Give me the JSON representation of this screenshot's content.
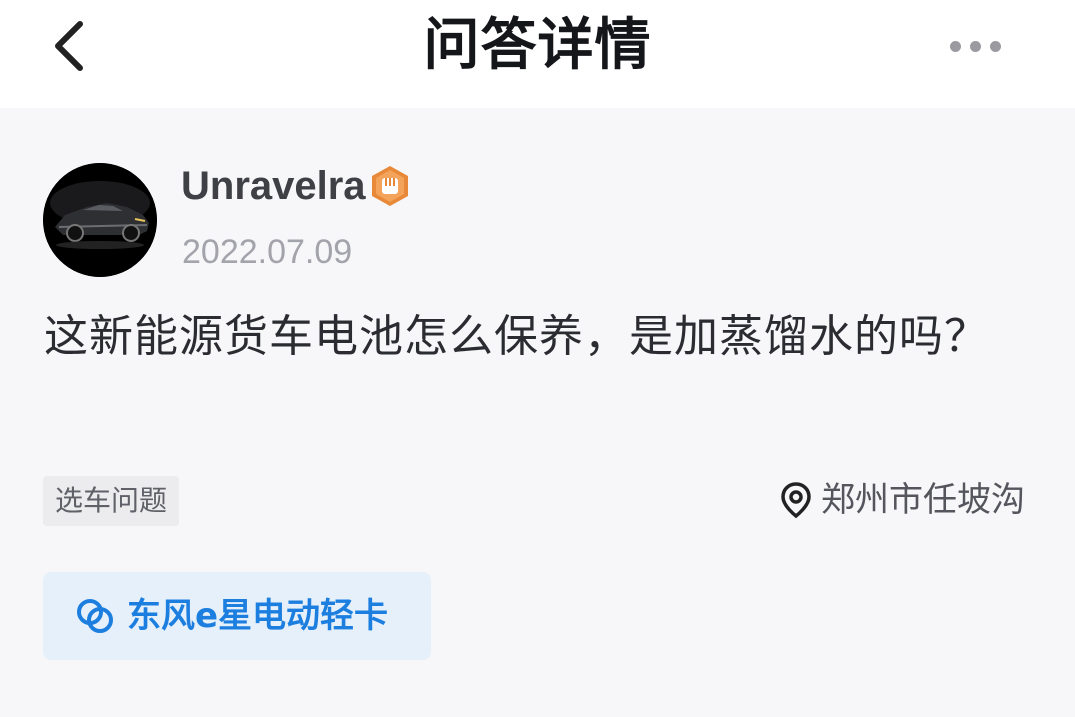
{
  "header": {
    "title": "问答详情",
    "back_icon": "chevron-left-icon",
    "more_icon": "more-dots-icon"
  },
  "author": {
    "name": "Unravelra",
    "badge_icon": "fist-badge-icon",
    "date": "2022.07.09",
    "avatar_icon": "sports-car-avatar"
  },
  "question": {
    "text": "这新能源货车电池怎么保养，是加蒸馏水的吗？"
  },
  "tag": {
    "label": "选车问题"
  },
  "location": {
    "icon": "location-pin-icon",
    "text": "郑州市任坡沟"
  },
  "vehicle": {
    "icon": "linked-rings-icon",
    "name": "东风e星电动轻卡"
  },
  "colors": {
    "accent": "#1c7fe0",
    "badge": "#e8893a",
    "background": "#f7f7f9"
  }
}
